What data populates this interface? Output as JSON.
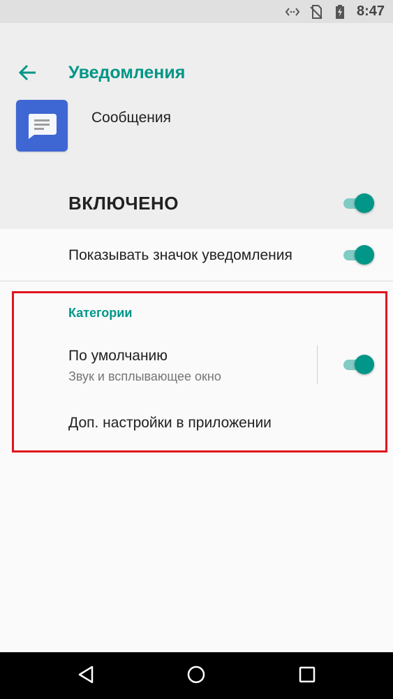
{
  "status_bar": {
    "time": "8:47",
    "icons": [
      "data-transfer-icon",
      "no-sim-icon",
      "battery-charging-icon"
    ]
  },
  "header": {
    "title": "Уведомления",
    "app_name": "Сообщения",
    "main_switch_label": "ВКЛЮЧЕНО",
    "main_switch_on": true
  },
  "settings": {
    "show_badge_label": "Показывать значок уведомления",
    "show_badge_on": true
  },
  "categories": {
    "section_title": "Категории",
    "default": {
      "label": "По умолчанию",
      "summary": "Звук и всплывающее окно",
      "on": true
    },
    "app_settings_label": "Доп. настройки в приложении"
  },
  "colors": {
    "accent": "#009688",
    "accent_light": "#80cbc4",
    "highlight": "#e0141e",
    "app_icon_bg": "#3f67d3"
  },
  "nav_bar": {
    "icons": [
      "back-triangle-icon",
      "home-circle-icon",
      "recents-square-icon"
    ]
  }
}
